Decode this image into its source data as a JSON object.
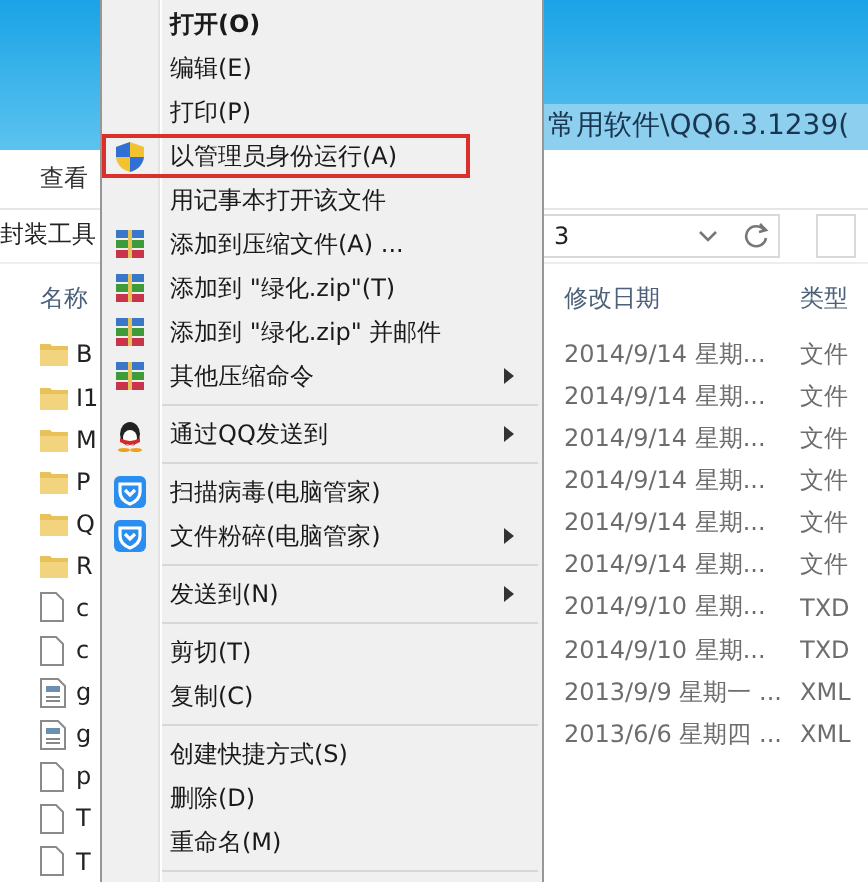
{
  "window": {
    "path": "常用软件\\QQ6.3.1239("
  },
  "ribbon": {
    "tab": "查看",
    "group": "封装工具"
  },
  "address": {
    "value": "3"
  },
  "columns": [
    "名称",
    "修改日期",
    "类型"
  ],
  "files": [
    {
      "kind": "folder",
      "name": "B",
      "date": "2014/9/14 星期...",
      "type": "文件"
    },
    {
      "kind": "folder",
      "name": "I1",
      "date": "2014/9/14 星期...",
      "type": "文件"
    },
    {
      "kind": "folder",
      "name": "M",
      "date": "2014/9/14 星期...",
      "type": "文件"
    },
    {
      "kind": "folder",
      "name": "P",
      "date": "2014/9/14 星期...",
      "type": "文件"
    },
    {
      "kind": "folder",
      "name": "Q",
      "date": "2014/9/14 星期...",
      "type": "文件"
    },
    {
      "kind": "folder",
      "name": "R",
      "date": "2014/9/14 星期...",
      "type": "文件"
    },
    {
      "kind": "file",
      "name": "c",
      "date": "2014/9/10 星期...",
      "type": "TXD"
    },
    {
      "kind": "file",
      "name": "c",
      "date": "2014/9/10 星期...",
      "type": "TXD"
    },
    {
      "kind": "xml",
      "name": "g",
      "date": "2013/9/9 星期一 ...",
      "type": "XML"
    },
    {
      "kind": "xml",
      "name": "g",
      "date": "2013/6/6 星期四 ...",
      "type": "XML"
    },
    {
      "kind": "file",
      "name": "p"
    },
    {
      "kind": "file",
      "name": "T"
    },
    {
      "kind": "file",
      "name": "T"
    }
  ],
  "menu": [
    {
      "kind": "plain",
      "label": "打开(O)",
      "bold": true
    },
    {
      "kind": "plain",
      "label": "编辑(E)"
    },
    {
      "kind": "plain",
      "label": "打印(P)"
    },
    {
      "kind": "shield",
      "label": "以管理员身份运行(A)",
      "highlighted": true
    },
    {
      "kind": "plain",
      "label": "用记事本打开该文件"
    },
    {
      "kind": "archive",
      "label": "添加到压缩文件(A) ..."
    },
    {
      "kind": "archive",
      "label": "添加到 \"绿化.zip\"(T)"
    },
    {
      "kind": "archive",
      "label": "添加到 \"绿化.zip\" 并邮件"
    },
    {
      "kind": "archive",
      "label": "其他压缩命令",
      "submenu": true
    },
    {
      "kind": "separator"
    },
    {
      "kind": "penguin",
      "label": "通过QQ发送到",
      "submenu": true
    },
    {
      "kind": "separator"
    },
    {
      "kind": "guard",
      "label": "扫描病毒(电脑管家)"
    },
    {
      "kind": "guard",
      "label": "文件粉碎(电脑管家)",
      "submenu": true
    },
    {
      "kind": "separator"
    },
    {
      "kind": "plain",
      "label": "发送到(N)",
      "submenu": true
    },
    {
      "kind": "separator"
    },
    {
      "kind": "plain",
      "label": "剪切(T)"
    },
    {
      "kind": "plain",
      "label": "复制(C)"
    },
    {
      "kind": "separator"
    },
    {
      "kind": "plain",
      "label": "创建快捷方式(S)"
    },
    {
      "kind": "plain",
      "label": "删除(D)"
    },
    {
      "kind": "plain",
      "label": "重命名(M)"
    },
    {
      "kind": "separator"
    }
  ]
}
